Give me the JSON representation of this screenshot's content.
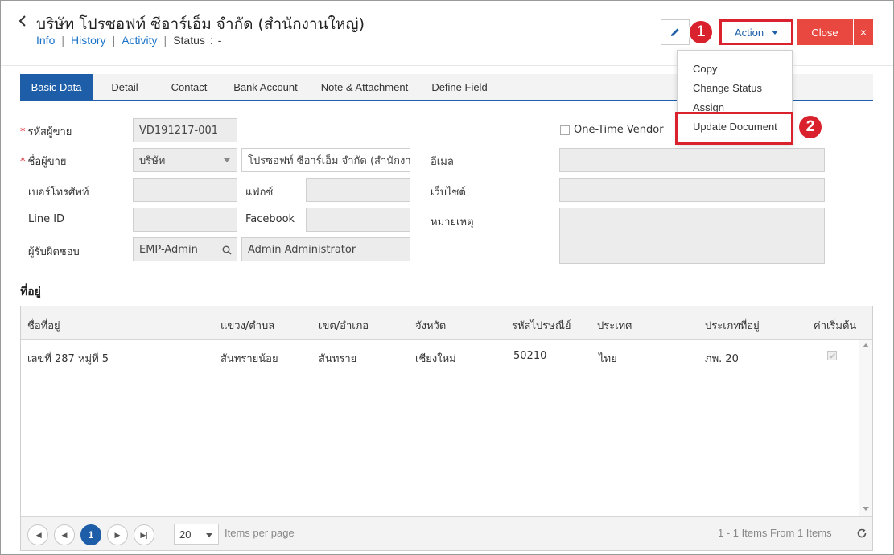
{
  "header": {
    "title": "บริษัท โปรซอฟท์ ซีอาร์เอ็ม จำกัด (สำนักงานใหญ่)",
    "links": [
      "Info",
      "History",
      "Activity"
    ],
    "status_label": "Status",
    "status_value": "-",
    "action_label": "Action",
    "close_label": "Close",
    "close_x": "×"
  },
  "annotations": {
    "step1": "1",
    "step2": "2",
    "highlight_color": "#d9222e"
  },
  "action_menu": [
    "Copy",
    "Change Status",
    "Assign",
    "Update Document"
  ],
  "tabs": [
    "Basic Data",
    "Detail",
    "Contact",
    "Bank Account",
    "Note & Attachment",
    "Define Field"
  ],
  "form": {
    "vendor_code_label": "รหัสผู้ขาย",
    "vendor_code": "VD191217-001",
    "one_time_vendor_label": "One-Time Vendor",
    "vendor_name_label": "ชื่อผู้ขาย",
    "name_prefix": "บริษัท",
    "vendor_name": "โปรซอฟท์ ซีอาร์เอ็ม จำกัด (สำนักงาน",
    "email_label": "อีเมล",
    "email": "",
    "phone_label": "เบอร์โทรศัพท์",
    "phone": "",
    "fax_label": "แฟกซ์",
    "fax": "",
    "website_label": "เว็บไซต์",
    "website": "",
    "line_label": "Line ID",
    "line_id": "",
    "facebook_label": "Facebook",
    "facebook": "",
    "remark_label": "หมายเหตุ",
    "remark": "",
    "owner_label": "ผู้รับผิดชอบ",
    "owner_code": "EMP-Admin",
    "owner_name": "Admin Administrator"
  },
  "address": {
    "section_title": "ที่อยู่",
    "columns": [
      "ชื่อที่อยู่",
      "แขวง/ตำบล",
      "เขต/อำเภอ",
      "จังหวัด",
      "รหัสไปรษณีย์",
      "ประเทศ",
      "ประเภทที่อยู่",
      "ค่าเริ่มต้น"
    ],
    "rows": [
      {
        "name": "เลขที่ 287 หมู่ที่ 5",
        "subdistrict": "สันทรายน้อย",
        "district": "สันทราย",
        "province": "เชียงใหม่",
        "postcode": "50210",
        "country": "ไทย",
        "type": "ภพ. 20",
        "default": true
      }
    ],
    "pager": {
      "current_page": "1",
      "page_size": "20",
      "per_page_label": "Items per page",
      "summary": "1 - 1 Items From 1 Items"
    }
  },
  "colors": {
    "primary": "#1e5ea8",
    "danger": "#e8483f",
    "link": "#1a73c8"
  }
}
